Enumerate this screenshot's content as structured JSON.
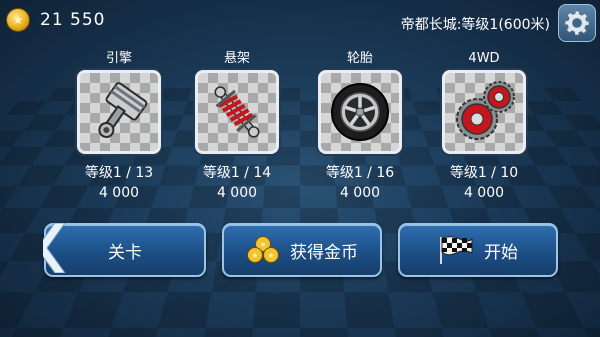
{
  "header": {
    "coins": "21 550",
    "level_info": "帝都长城:等级1(600米)"
  },
  "parts": [
    {
      "name": "引擎",
      "level": "等级1 / 13",
      "price": "4 000",
      "icon": "piston-icon"
    },
    {
      "name": "悬架",
      "level": "等级1 / 14",
      "price": "4 000",
      "icon": "suspension-spring-icon"
    },
    {
      "name": "轮胎",
      "level": "等级1 / 16",
      "price": "4 000",
      "icon": "tire-wheel-icon"
    },
    {
      "name": "4WD",
      "level": "等级1 / 10",
      "price": "4 000",
      "icon": "gears-icon"
    }
  ],
  "buttons": {
    "stage": "关卡",
    "get_coins": "获得金币",
    "start": "开始"
  },
  "colors": {
    "background": "#1b3a58",
    "button": "#1c4f86",
    "button_border": "#9cc4e6",
    "coin": "#e8b020"
  }
}
